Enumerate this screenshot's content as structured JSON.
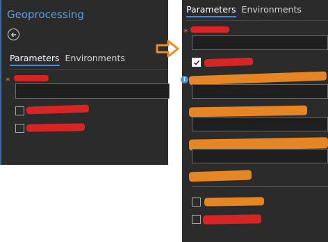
{
  "left": {
    "title": "Geoprocessing",
    "tabs": [
      "Parameters",
      "Environments"
    ],
    "required_marker": "*"
  },
  "right": {
    "tabs": [
      "Parameters",
      "Environments"
    ],
    "required_marker": "*",
    "info_marker": "i"
  },
  "icons": {
    "back": "back-arrow-icon",
    "transition": "right-arrow-icon",
    "check": "checkmark-icon",
    "info": "info-icon"
  },
  "colors": {
    "panel_bg": "#2b2b2b",
    "title_blue": "#5aa0e8",
    "tab_underline": "#3c8de0",
    "required_orange": "#e07b2a",
    "redaction_red": "#e02424",
    "redaction_orange": "#f08a24",
    "arrow_orange": "#f08a24"
  }
}
